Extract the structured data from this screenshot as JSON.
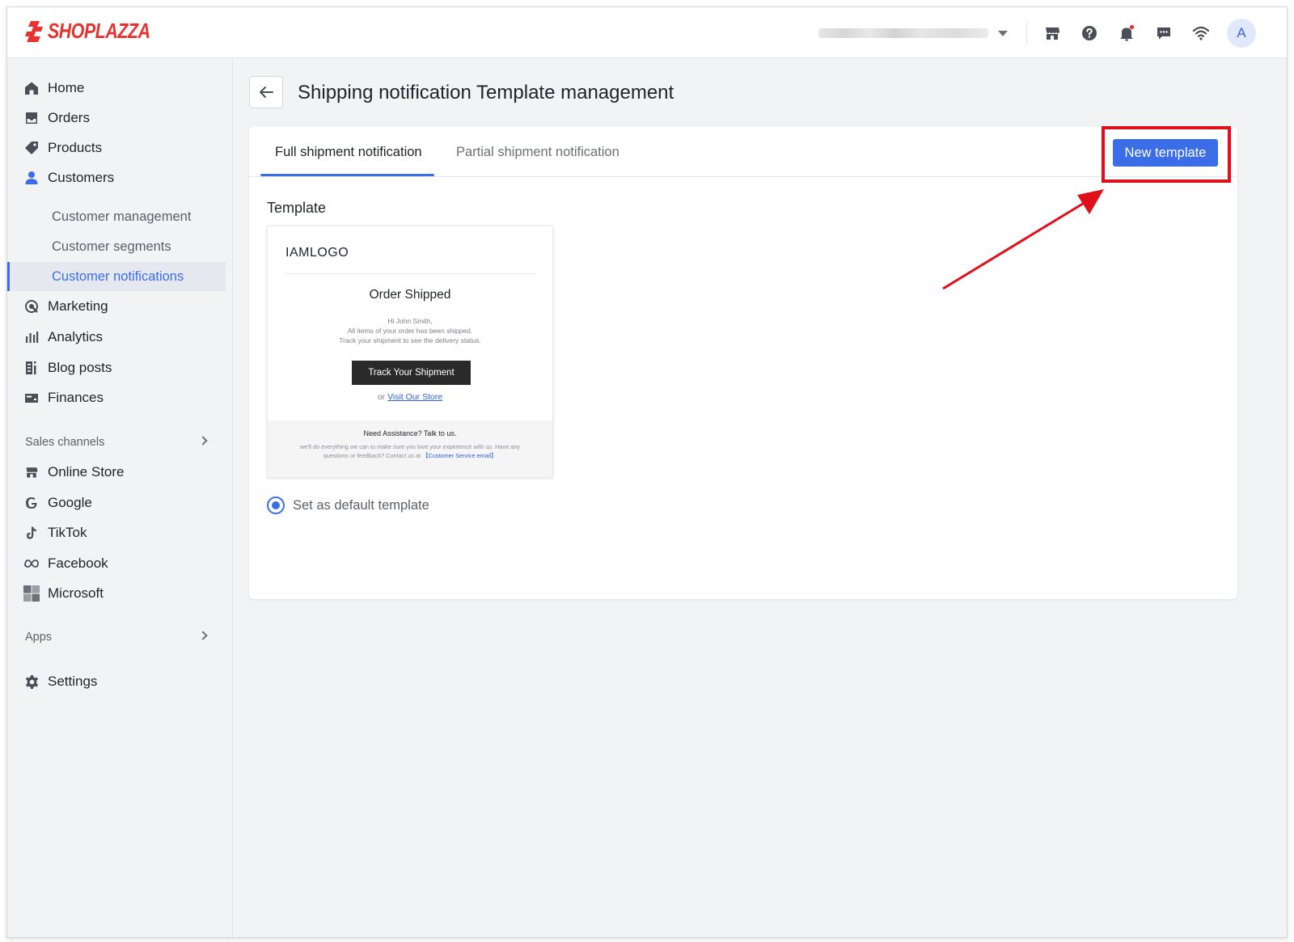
{
  "brand": {
    "name": "SHOPLAZZA",
    "color": "#e8322f"
  },
  "topbar": {
    "icons": [
      "store-icon",
      "help-icon",
      "bell-icon",
      "chat-icon",
      "wifi-icon"
    ],
    "avatar_initial": "A"
  },
  "sidebar": {
    "items": [
      {
        "label": "Home",
        "icon": "home-icon"
      },
      {
        "label": "Orders",
        "icon": "orders-icon"
      },
      {
        "label": "Products",
        "icon": "tag-icon"
      },
      {
        "label": "Customers",
        "icon": "person-icon"
      }
    ],
    "customer_sub": [
      {
        "label": "Customer management"
      },
      {
        "label": "Customer segments"
      },
      {
        "label": "Customer notifications",
        "active": true
      }
    ],
    "items2": [
      {
        "label": "Marketing",
        "icon": "marketing-icon"
      },
      {
        "label": "Analytics",
        "icon": "analytics-icon"
      },
      {
        "label": "Blog posts",
        "icon": "blog-icon"
      },
      {
        "label": "Finances",
        "icon": "finances-icon"
      }
    ],
    "sales_channels_label": "Sales channels",
    "channels": [
      {
        "label": "Online Store",
        "icon": "store-icon"
      },
      {
        "label": "Google",
        "icon": "google-icon"
      },
      {
        "label": "TikTok",
        "icon": "tiktok-icon"
      },
      {
        "label": "Facebook",
        "icon": "meta-icon"
      },
      {
        "label": "Microsoft",
        "icon": "microsoft-icon"
      }
    ],
    "apps_label": "Apps",
    "settings_label": "Settings"
  },
  "main": {
    "title": "Shipping notification Template management",
    "tabs": [
      {
        "label": "Full shipment notification",
        "active": true
      },
      {
        "label": "Partial shipment notification",
        "active": false
      }
    ],
    "new_template_label": "New template",
    "template_label": "Template",
    "preview": {
      "logo": "IAMLOGO",
      "heading": "Order Shipped",
      "greeting": "Hi John Smith,",
      "line1": "All items of your order has been shipped.",
      "line2": "Track your shipment to see the delivery status.",
      "button": "Track Your Shipment",
      "or_text": "or",
      "store_link": "Visit Our Store",
      "footer_title": "Need Assistance? Talk to us.",
      "footer_line1": "we'll do everything we can to make sure you love your experience with us. Have any",
      "footer_line2": "questions or feedback? Contact us at",
      "footer_link": "【Customer Service email】"
    },
    "default_label": "Set as default template"
  },
  "colors": {
    "accent": "#3b6ee6",
    "highlight": "#e0101a"
  }
}
